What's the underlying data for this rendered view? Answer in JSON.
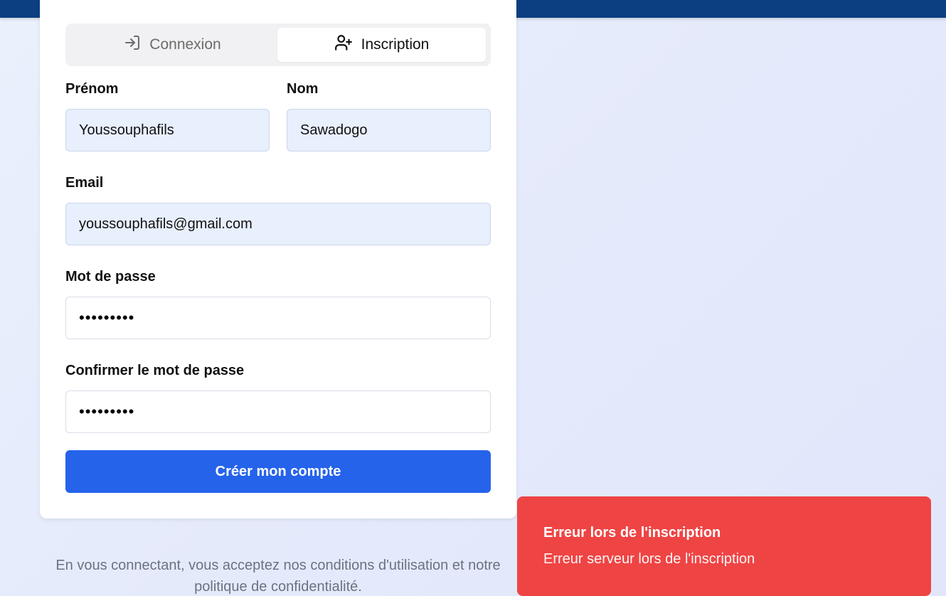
{
  "tabs": {
    "login_label": "Connexion",
    "signup_label": "Inscription"
  },
  "form": {
    "first_name_label": "Prénom",
    "first_name_value": "Youssouphafils",
    "last_name_label": "Nom",
    "last_name_value": "Sawadogo",
    "email_label": "Email",
    "email_value": "youssouphafils@gmail.com",
    "password_label": "Mot de passe",
    "password_value": "•••••••••",
    "confirm_label": "Confirmer le mot de passe",
    "confirm_value": "•••••••••",
    "submit_label": "Créer mon compte"
  },
  "terms_text": "En vous connectant, vous acceptez nos conditions d'utilisation et notre politique de confidentialité.",
  "toast": {
    "title": "Erreur lors de l'inscription",
    "message": "Erreur serveur lors de l'inscription"
  },
  "colors": {
    "primary": "#2563eb",
    "error": "#ef4444",
    "header": "#0b3f82"
  },
  "icons": {
    "login": "log-in-icon",
    "signup": "user-plus-icon"
  }
}
